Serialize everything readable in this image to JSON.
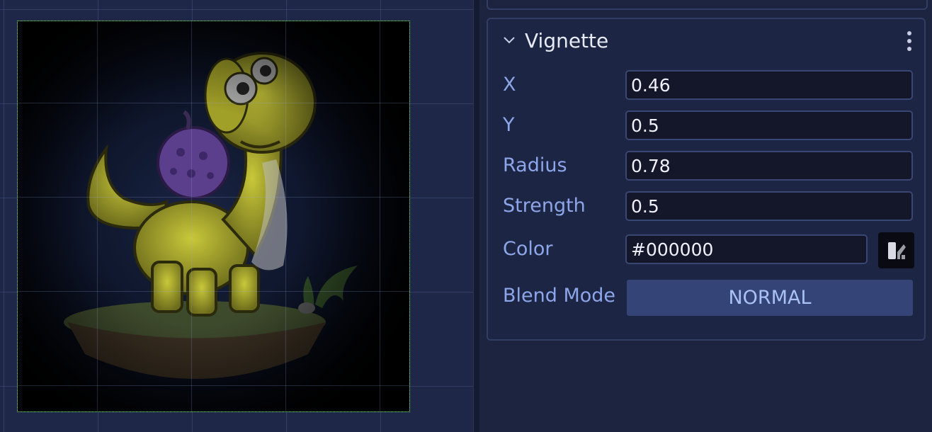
{
  "viewport": {
    "image": "dinosaur-sprite-with-vignette"
  },
  "panel": {
    "section": {
      "title": "Vignette",
      "collapse_icon": "chevron-down-icon",
      "menu_icon": "kebab-menu-icon"
    },
    "properties": {
      "x": {
        "label": "X",
        "value": "0.46"
      },
      "y": {
        "label": "Y",
        "value": "0.5"
      },
      "radius": {
        "label": "Radius",
        "value": "0.78"
      },
      "strength": {
        "label": "Strength",
        "value": "0.5"
      },
      "color": {
        "label": "Color",
        "value": "#000000",
        "picker_icon": "color-picker-icon"
      },
      "blend_mode": {
        "label": "Blend Mode",
        "value": "NORMAL"
      }
    }
  },
  "colors": {
    "accent": "#344477",
    "label": "#8da6ea",
    "canvas_outline": "#7dff4a"
  }
}
